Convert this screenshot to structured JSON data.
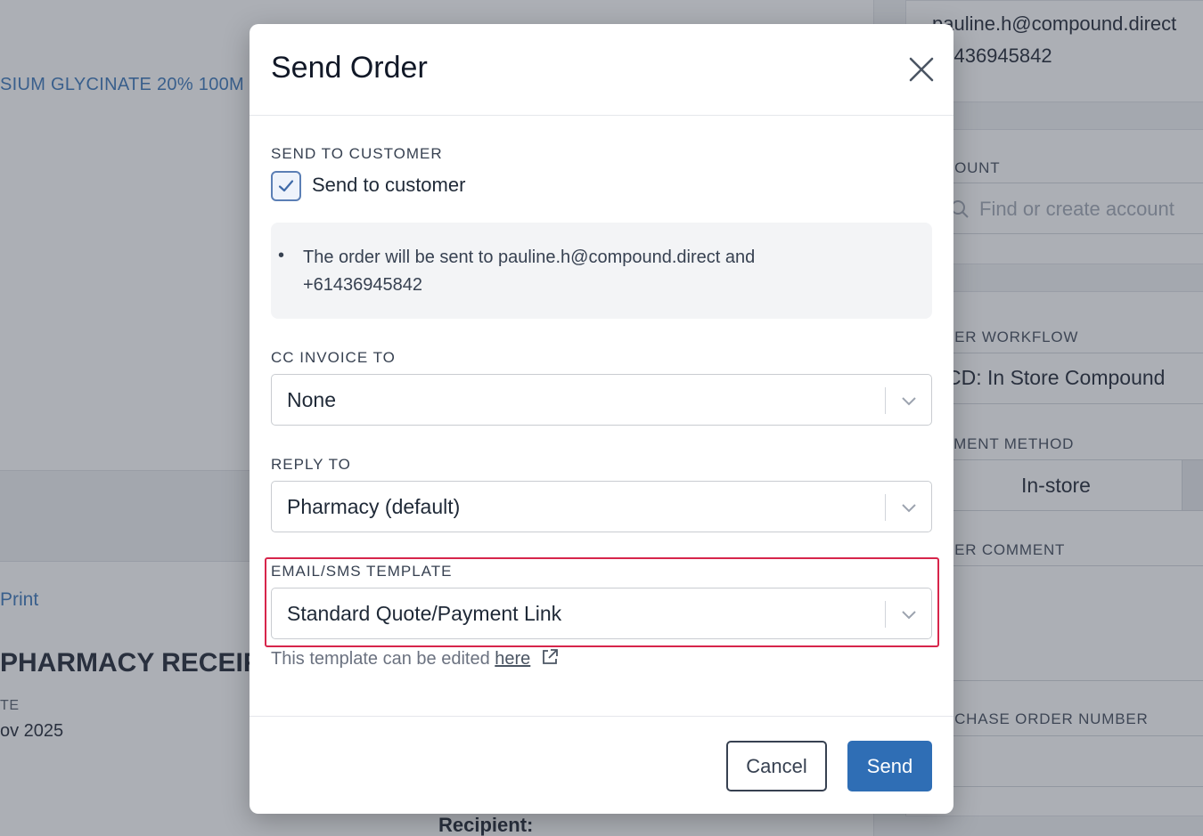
{
  "background": {
    "product_name": "SIUM GLYCINATE 20% 100M",
    "print_link": "Print",
    "receipt_title": "PHARMACY RECEIF",
    "date_label": "TE",
    "date_value": "ov 2025",
    "recipient_label": "Recipient:"
  },
  "right_panel": {
    "email": "pauline.h@compound.direct",
    "phone": "61436945842",
    "account_label": "COUNT",
    "account_placeholder": "Find or create account",
    "workflow_label": "DER WORKFLOW",
    "workflow_value": "CD: In Store Compound",
    "payment_label": "YMENT METHOD",
    "payment_value": "In-store",
    "comment_label": "DER COMMENT",
    "po_label": "RCHASE ORDER NUMBER"
  },
  "modal": {
    "title": "Send Order",
    "send_to_customer": {
      "section_label": "SEND TO CUSTOMER",
      "checkbox_label": "Send to customer",
      "checked": true,
      "info_text": "The order will be sent to pauline.h@compound.direct and +61436945842"
    },
    "cc_invoice": {
      "label": "CC INVOICE TO",
      "value": "None"
    },
    "reply_to": {
      "label": "REPLY TO",
      "value": "Pharmacy (default)"
    },
    "template": {
      "label": "EMAIL/SMS TEMPLATE",
      "value": "Standard Quote/Payment Link",
      "helper_text": "This template can be edited",
      "helper_link": "here"
    },
    "buttons": {
      "cancel": "Cancel",
      "send": "Send"
    }
  },
  "colors": {
    "primary": "#2f6eb5",
    "highlight_border": "#d7254b",
    "overlay": "rgba(70,78,92,0.45)"
  }
}
